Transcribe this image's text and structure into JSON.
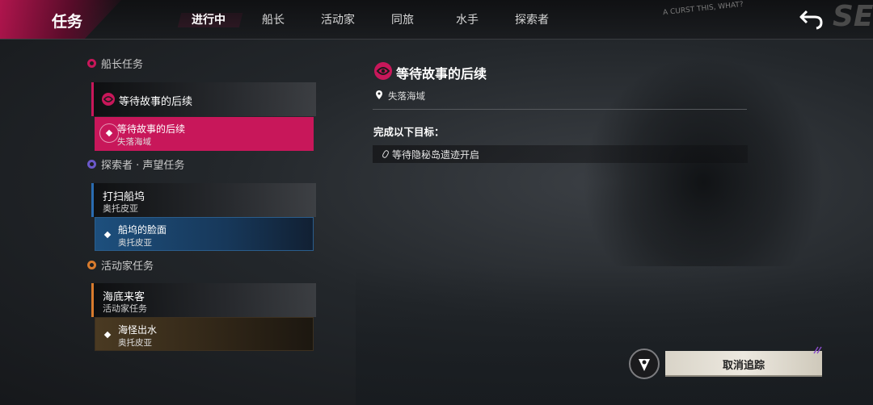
{
  "header": {
    "title": "任务",
    "tabs": [
      {
        "label": "进行中",
        "active": true
      },
      {
        "label": "船长"
      },
      {
        "label": "活动家"
      },
      {
        "label": "同旅"
      },
      {
        "label": "水手"
      },
      {
        "label": "探索者"
      }
    ],
    "scribble": "A CURST THIS, WHAT?",
    "corner_letters": "SE"
  },
  "sections": {
    "captain": {
      "title": "船长任务",
      "card_title": "等待故事的后续",
      "item_title": "等待故事的后续",
      "item_sub": "失落海域"
    },
    "explorer": {
      "title": "探索者 · 声望任务",
      "card_title": "打扫船坞",
      "card_sub": "奥托皮亚",
      "item_title": "船坞的脸面",
      "item_sub": "奥托皮亚"
    },
    "activist": {
      "title": "活动家任务",
      "card_title": "海底来客",
      "card_sub": "活动家任务",
      "item_title": "海怪出水",
      "item_sub": "奥托皮亚"
    }
  },
  "detail": {
    "title": "等待故事的后续",
    "location": "失落海域",
    "objectives_header": "完成以下目标：",
    "objectives": [
      "等待隐秘岛遗迹开启"
    ]
  },
  "actions": {
    "untrack_label": "取消追踪"
  },
  "colors": {
    "accent": "#c8175a",
    "explorer": "#2a6bb0",
    "activist": "#d87b2d"
  }
}
